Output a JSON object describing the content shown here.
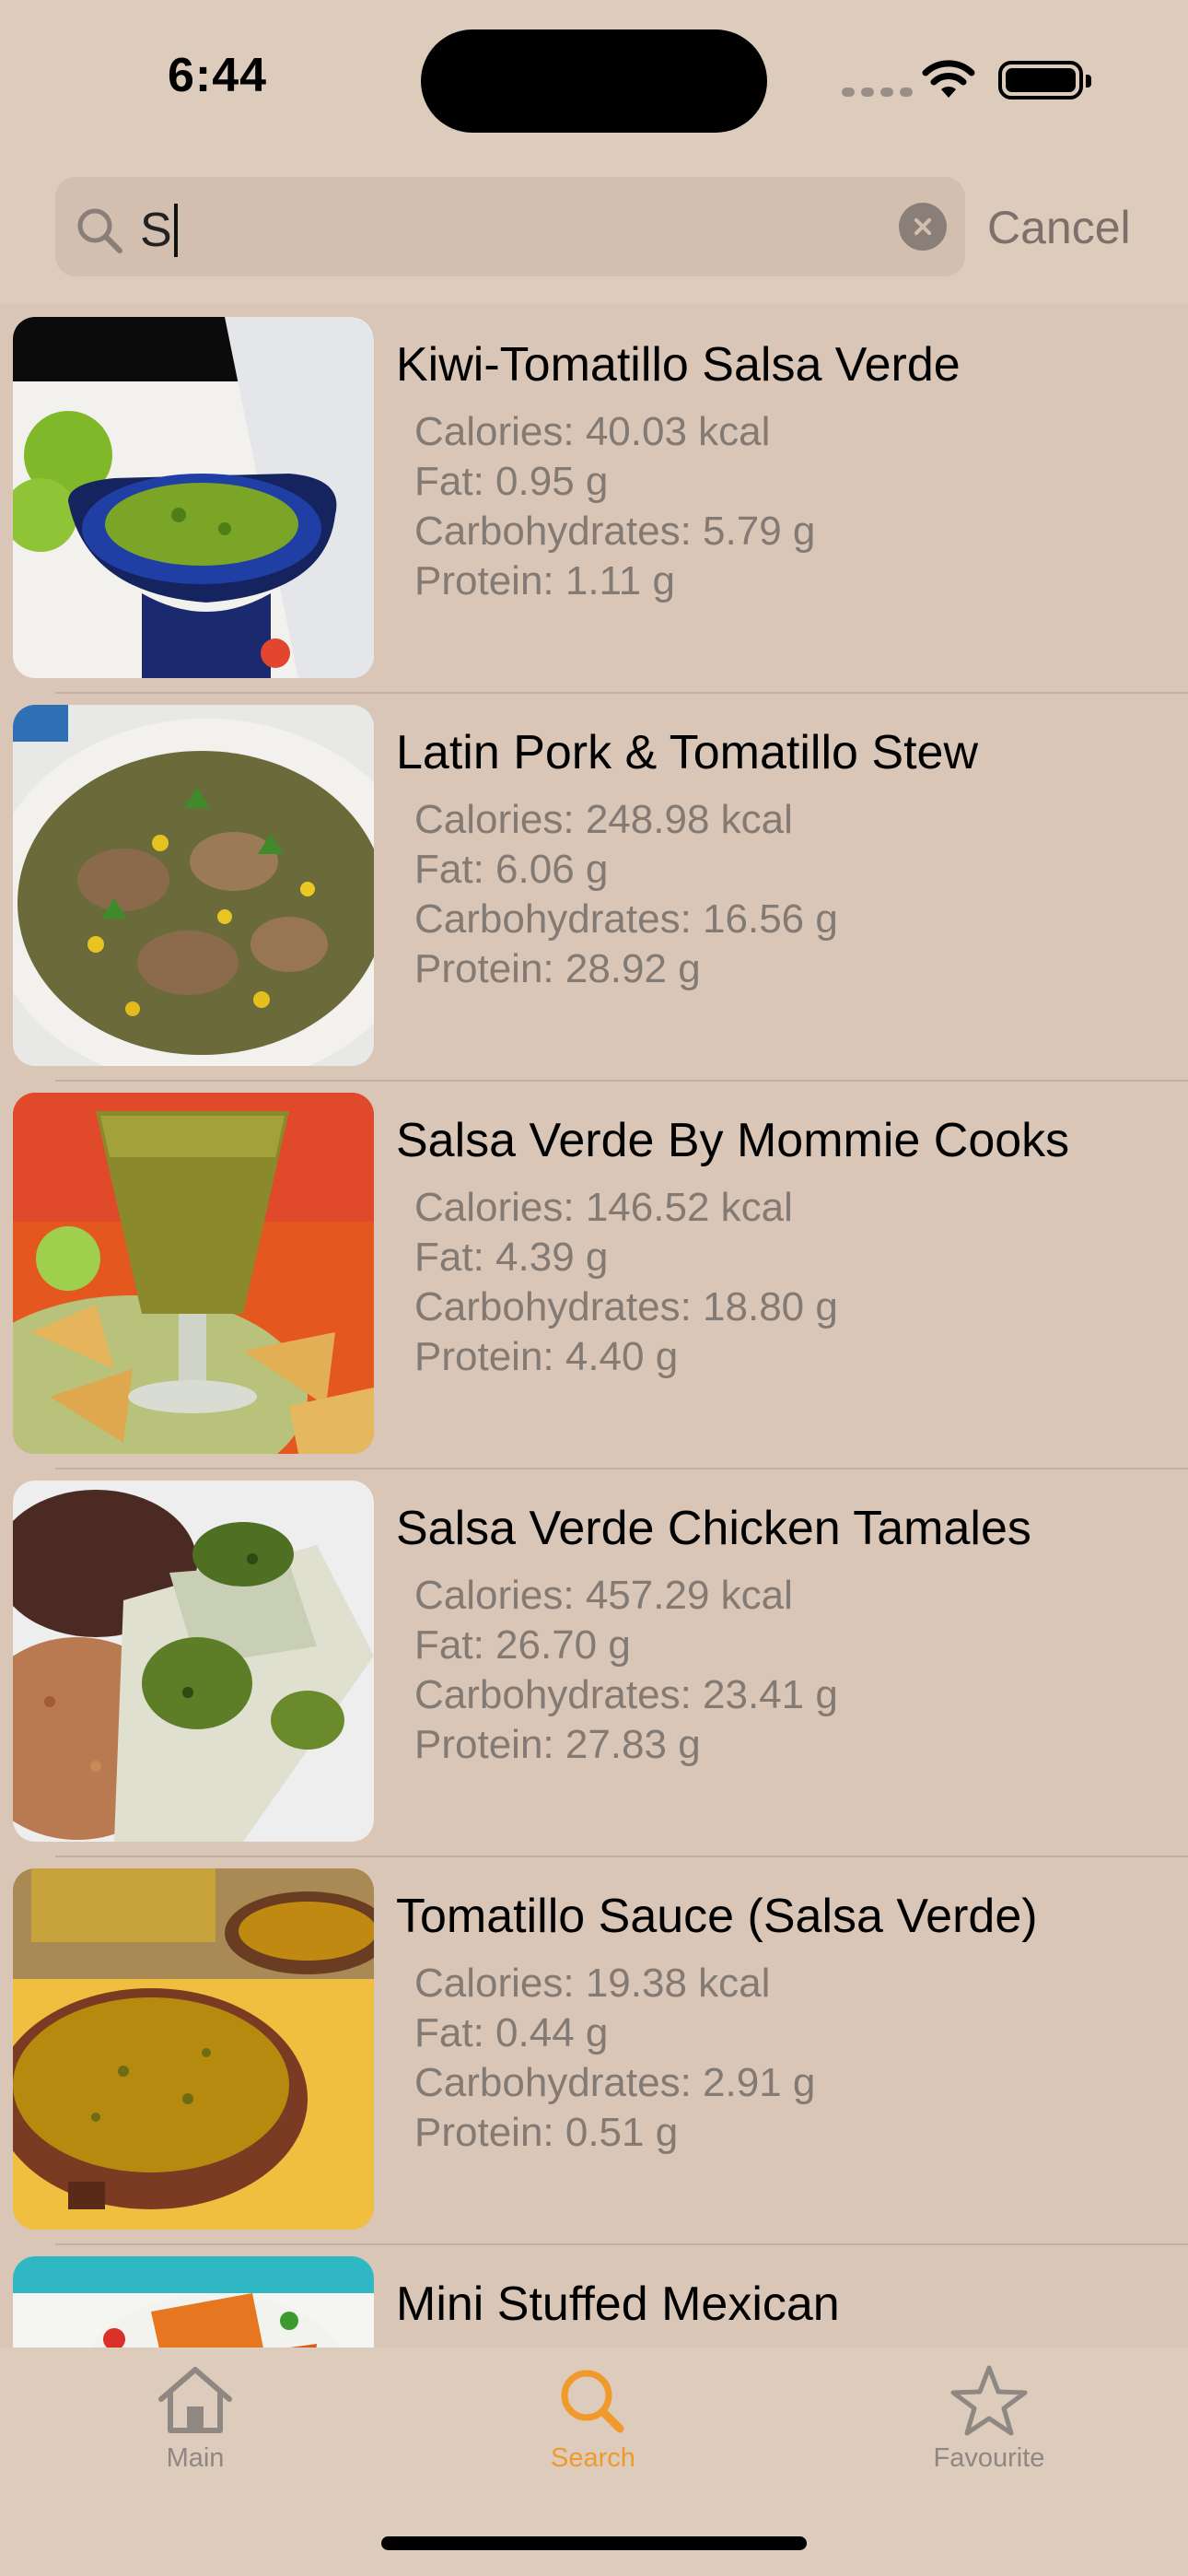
{
  "status_bar": {
    "time": "6:44"
  },
  "search": {
    "query": "S",
    "cancel_label": "Cancel"
  },
  "results": [
    {
      "title": "Kiwi-Tomatillo Salsa Verde",
      "calories": "Calories: 40.03 kcal",
      "fat": "Fat: 0.95 g",
      "carbs": "Carbohydrates: 5.79 g",
      "protein": "Protein: 1.11 g"
    },
    {
      "title": "Latin Pork & Tomatillo Stew",
      "calories": "Calories: 248.98 kcal",
      "fat": "Fat: 6.06 g",
      "carbs": "Carbohydrates: 16.56 g",
      "protein": "Protein: 28.92 g"
    },
    {
      "title": "Salsa Verde By Mommie Cooks",
      "calories": "Calories: 146.52 kcal",
      "fat": "Fat: 4.39 g",
      "carbs": "Carbohydrates: 18.80 g",
      "protein": "Protein: 4.40 g"
    },
    {
      "title": "Salsa Verde Chicken Tamales",
      "calories": "Calories: 457.29 kcal",
      "fat": "Fat: 26.70 g",
      "carbs": "Carbohydrates: 23.41 g",
      "protein": "Protein: 27.83 g"
    },
    {
      "title": "Tomatillo Sauce (Salsa Verde)",
      "calories": "Calories: 19.38 kcal",
      "fat": "Fat: 0.44 g",
      "carbs": "Carbohydrates: 2.91 g",
      "protein": "Protein: 0.51 g"
    },
    {
      "title": "Mini Stuffed Mexican",
      "calories": "",
      "fat": "",
      "carbs": "",
      "protein": ""
    }
  ],
  "tabs": [
    {
      "label": "Main",
      "icon": "house-icon"
    },
    {
      "label": "Search",
      "icon": "magnifying-glass-icon",
      "active": true
    },
    {
      "label": "Favourite",
      "icon": "star-icon"
    }
  ],
  "colors": {
    "background": "#d9c6b6",
    "accent": "#ef9a2a",
    "secondary_text": "#847a74"
  }
}
